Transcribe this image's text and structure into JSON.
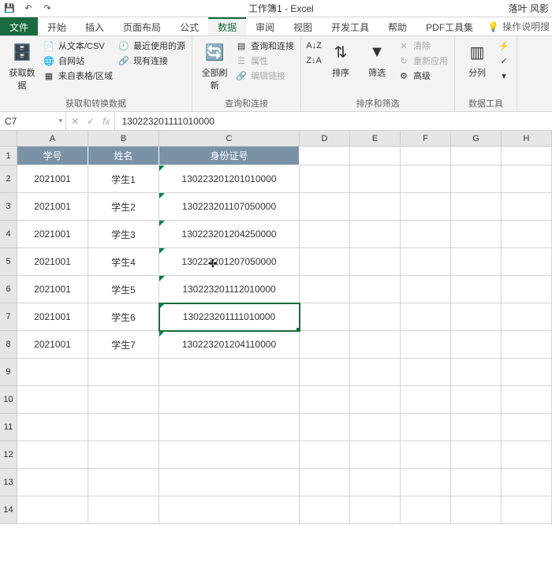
{
  "title": "工作簿1 - Excel",
  "account": "落叶 风影",
  "qat": {
    "save": "💾",
    "undo": "↶",
    "redo": "↷"
  },
  "tabs": {
    "file": "文件",
    "items": [
      "开始",
      "插入",
      "页面布局",
      "公式",
      "数据",
      "审阅",
      "视图",
      "开发工具",
      "帮助",
      "PDF工具集"
    ],
    "active_index": 4,
    "tell_me": "操作说明搜"
  },
  "ribbon": {
    "g1": {
      "big": "获取数据",
      "items": [
        "从文本/CSV",
        "自网站",
        "来自表格/区域",
        "最近使用的源",
        "现有连接"
      ],
      "label": "获取和转换数据"
    },
    "g2": {
      "big": "全部刷新",
      "items": [
        "查询和连接",
        "属性",
        "编辑链接"
      ],
      "label": "查询和连接"
    },
    "g3": {
      "sort_az": "A↓Z",
      "sort": "排序",
      "filter": "筛选",
      "clear": "清除",
      "reapply": "重新应用",
      "advanced": "高级",
      "label": "排序和筛选"
    },
    "g4": {
      "big": "分列",
      "label": "数据工具"
    }
  },
  "name_box": "C7",
  "formula": "130223201111010000",
  "columns": [
    "A",
    "B",
    "C",
    "D",
    "E",
    "F",
    "G",
    "H"
  ],
  "col_widths": [
    "cw-a",
    "cw-b",
    "cw-c",
    "cw-d",
    "cw-e",
    "cw-f",
    "cw-g",
    "cw-h"
  ],
  "table_header": [
    "学号",
    "姓名",
    "身份证号"
  ],
  "data_rows": [
    [
      "2021001",
      "学生1",
      "130223201201010000"
    ],
    [
      "2021001",
      "学生2",
      "130223201107050000"
    ],
    [
      "2021001",
      "学生3",
      "130223201204250000"
    ],
    [
      "2021001",
      "学生4",
      "130223201207050000"
    ],
    [
      "2021001",
      "学生5",
      "130223201112010000"
    ],
    [
      "2021001",
      "学生6",
      "130223201111010000"
    ],
    [
      "2021001",
      "学生7",
      "130223201204110000"
    ]
  ],
  "selected_row_index": 5,
  "empty_rows": 6
}
